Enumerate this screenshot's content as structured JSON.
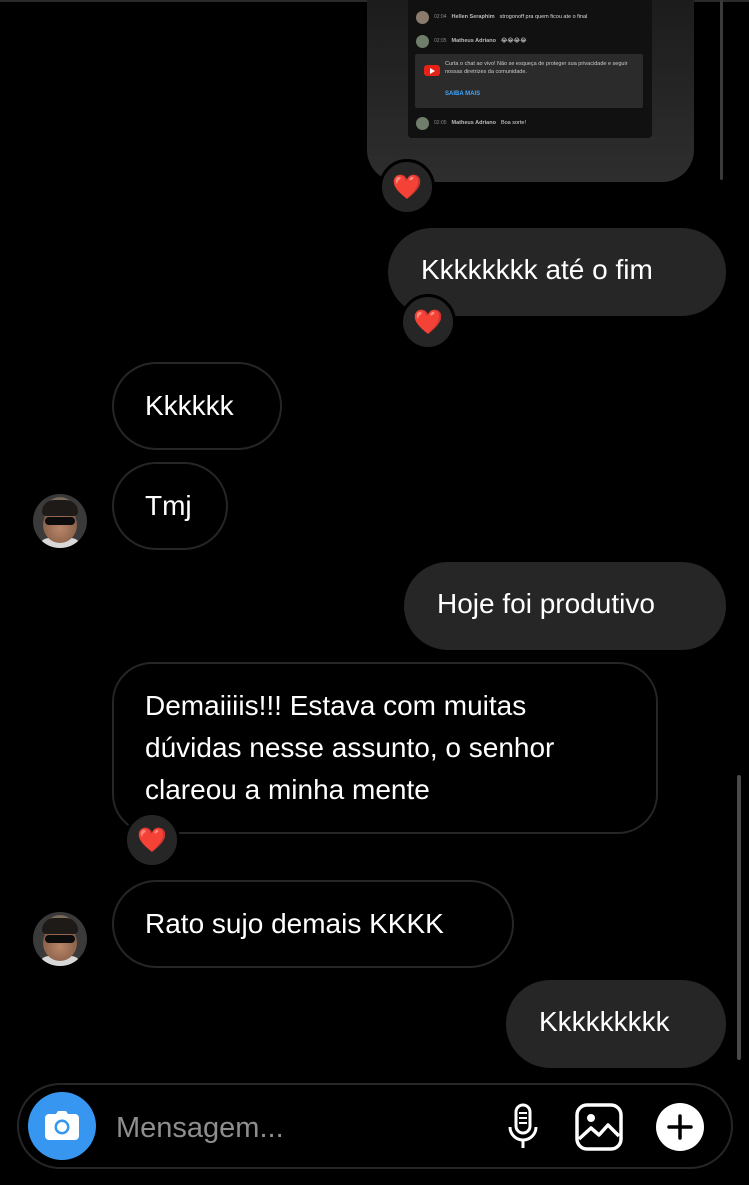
{
  "shared_post": {
    "chat_rows": [
      {
        "time": "02:04",
        "name": "Hellen Seraphim",
        "message": "strogonoff pra quem ficou ate o final"
      },
      {
        "time": "02:05",
        "name": "Matheus Adriano",
        "message": "😂😂😂😂"
      },
      {
        "time": "02:05",
        "name": "Matheus Adriano",
        "message": "Boa sorte!"
      }
    ],
    "notice_text": "Curta o chat ao vivo! Não se esqueça de proteger sua privacidade e seguir nossas diretrizes da comunidade.",
    "notice_link": "SAIBA MAIS",
    "reaction": "❤️"
  },
  "messages": [
    {
      "direction": "out",
      "text": "Kkkkkkkk até o fim",
      "reaction": "❤️"
    },
    {
      "direction": "in",
      "text": "Kkkkkk"
    },
    {
      "direction": "in",
      "text": "Tmj"
    },
    {
      "direction": "out",
      "text": "Hoje foi produtivo"
    },
    {
      "direction": "in",
      "lines": [
        "Demaiiiis!!! Estava com muitas",
        "dúvidas nesse assunto, o senhor",
        "clareou a minha mente"
      ],
      "reaction": "❤️"
    },
    {
      "direction": "in",
      "text": "Rato sujo demais KKKK"
    },
    {
      "direction": "out",
      "text": "Kkkkkkkkk"
    }
  ],
  "composer": {
    "placeholder": "Mensagem...",
    "value": ""
  },
  "icons": {
    "camera": "camera-icon",
    "mic": "microphone-icon",
    "gallery": "gallery-icon",
    "plus": "plus-icon"
  },
  "colors": {
    "background": "#000000",
    "bubble_out": "#262626",
    "bubble_in_border": "#262626",
    "accent": "#3797f0"
  }
}
